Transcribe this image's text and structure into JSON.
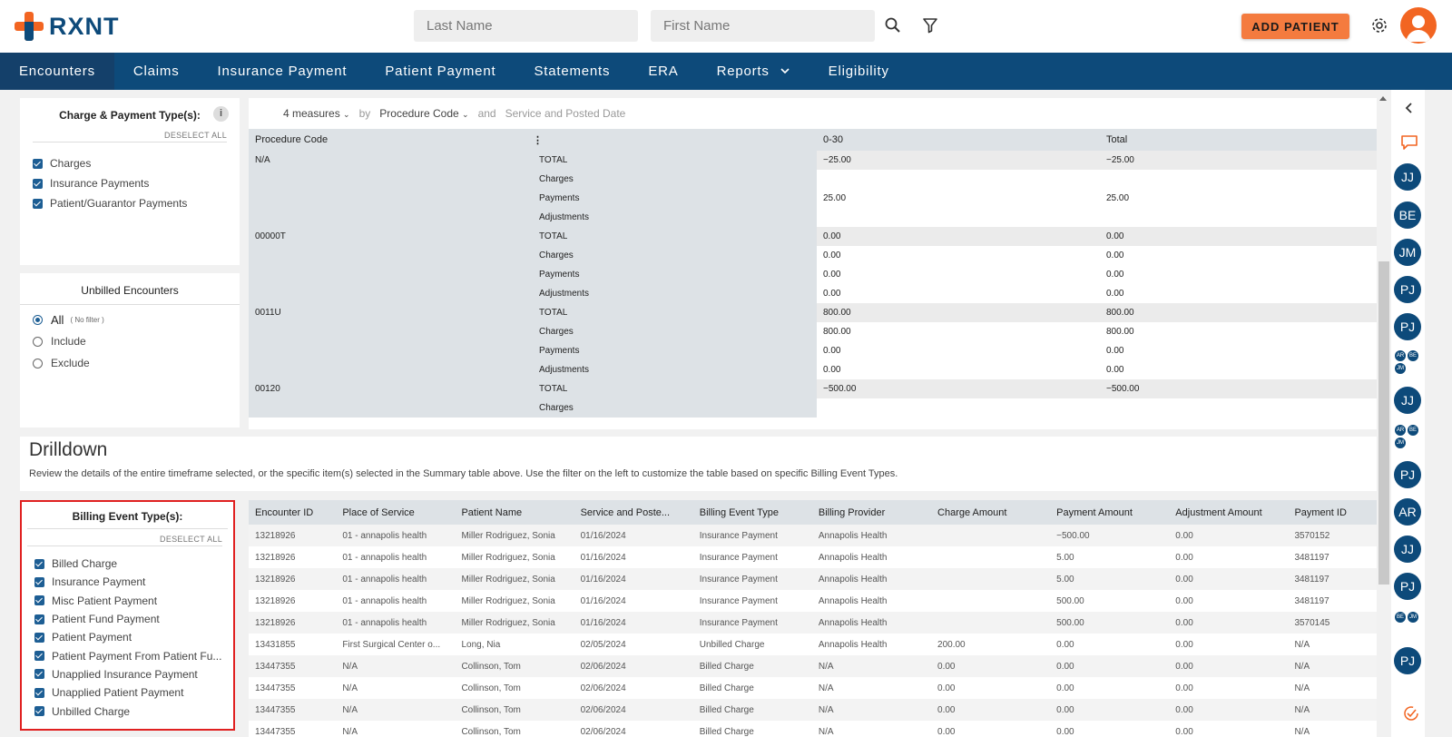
{
  "header": {
    "logo": "RXNT",
    "last_name_placeholder": "Last Name",
    "first_name_placeholder": "First Name",
    "add_patient": "ADD PATIENT"
  },
  "nav": [
    "Encounters",
    "Claims",
    "Insurance Payment",
    "Patient Payment",
    "Statements",
    "ERA",
    "Reports",
    "Eligibility"
  ],
  "charge_filter": {
    "title": "Charge & Payment Type(s):",
    "info": "i",
    "deselect": "DESELECT ALL",
    "items": [
      "Charges",
      "Insurance Payments",
      "Patient/Guarantor Payments"
    ]
  },
  "unbilled": {
    "title": "Unbilled Encounters",
    "options": [
      "All",
      "Include",
      "Exclude"
    ],
    "all_note": "( No filter )"
  },
  "pivot": {
    "measures": "4 measures",
    "by": "by",
    "group": "Procedure Code",
    "and": "and",
    "extra": "Service and Posted Date",
    "col_code": "Procedure Code",
    "col_range": "0-30",
    "col_total": "Total",
    "rows": [
      {
        "code": "N/A",
        "label": "TOTAL",
        "v": "−25.00",
        "t": "−25.00"
      },
      {
        "code": "",
        "label": "Charges",
        "v": "",
        "t": ""
      },
      {
        "code": "",
        "label": "Payments",
        "v": "25.00",
        "t": "25.00"
      },
      {
        "code": "",
        "label": "Adjustments",
        "v": "",
        "t": ""
      },
      {
        "code": "00000T",
        "label": "TOTAL",
        "v": "0.00",
        "t": "0.00"
      },
      {
        "code": "",
        "label": "Charges",
        "v": "0.00",
        "t": "0.00"
      },
      {
        "code": "",
        "label": "Payments",
        "v": "0.00",
        "t": "0.00"
      },
      {
        "code": "",
        "label": "Adjustments",
        "v": "0.00",
        "t": "0.00"
      },
      {
        "code": "0011U",
        "label": "TOTAL",
        "v": "800.00",
        "t": "800.00"
      },
      {
        "code": "",
        "label": "Charges",
        "v": "800.00",
        "t": "800.00"
      },
      {
        "code": "",
        "label": "Payments",
        "v": "0.00",
        "t": "0.00"
      },
      {
        "code": "",
        "label": "Adjustments",
        "v": "0.00",
        "t": "0.00"
      },
      {
        "code": "00120",
        "label": "TOTAL",
        "v": "−500.00",
        "t": "−500.00"
      },
      {
        "code": "",
        "label": "Charges",
        "v": "",
        "t": ""
      }
    ]
  },
  "drilldown": {
    "title": "Drilldown",
    "description": "Review the details of the entire timeframe selected, or the specific item(s) selected in the Summary table above. Use the filter on the left to customize the table based on specific Billing Event Types."
  },
  "billing_filter": {
    "title": "Billing Event Type(s):",
    "deselect": "DESELECT ALL",
    "items": [
      "Billed Charge",
      "Insurance Payment",
      "Misc Patient Payment",
      "Patient Fund Payment",
      "Patient Payment",
      "Patient Payment From Patient Fu...",
      "Unapplied Insurance Payment",
      "Unapplied Patient Payment",
      "Unbilled Charge"
    ]
  },
  "table": {
    "columns": [
      "Encounter ID",
      "Place of Service",
      "Patient Name",
      "Service and Poste...",
      "Billing Event Type",
      "Billing Provider",
      "Charge Amount",
      "Payment Amount",
      "Adjustment Amount",
      "Payment ID"
    ],
    "rows": [
      [
        "13218926",
        "01 - annapolis health",
        "Miller Rodriguez, Sonia",
        "01/16/2024",
        "Insurance Payment",
        "Annapolis Health",
        "",
        "−500.00",
        "0.00",
        "3570152"
      ],
      [
        "13218926",
        "01 - annapolis health",
        "Miller Rodriguez, Sonia",
        "01/16/2024",
        "Insurance Payment",
        "Annapolis Health",
        "",
        "5.00",
        "0.00",
        "3481197"
      ],
      [
        "13218926",
        "01 - annapolis health",
        "Miller Rodriguez, Sonia",
        "01/16/2024",
        "Insurance Payment",
        "Annapolis Health",
        "",
        "5.00",
        "0.00",
        "3481197"
      ],
      [
        "13218926",
        "01 - annapolis health",
        "Miller Rodriguez, Sonia",
        "01/16/2024",
        "Insurance Payment",
        "Annapolis Health",
        "",
        "500.00",
        "0.00",
        "3481197"
      ],
      [
        "13218926",
        "01 - annapolis health",
        "Miller Rodriguez, Sonia",
        "01/16/2024",
        "Insurance Payment",
        "Annapolis Health",
        "",
        "500.00",
        "0.00",
        "3570145"
      ],
      [
        "13431855",
        "First Surgical Center o...",
        "Long, Nia",
        "02/05/2024",
        "Unbilled Charge",
        "Annapolis Health",
        "200.00",
        "0.00",
        "0.00",
        "N/A"
      ],
      [
        "13447355",
        "N/A",
        "Collinson, Tom",
        "02/06/2024",
        "Billed Charge",
        "N/A",
        "0.00",
        "0.00",
        "0.00",
        "N/A"
      ],
      [
        "13447355",
        "N/A",
        "Collinson, Tom",
        "02/06/2024",
        "Billed Charge",
        "N/A",
        "0.00",
        "0.00",
        "0.00",
        "N/A"
      ],
      [
        "13447355",
        "N/A",
        "Collinson, Tom",
        "02/06/2024",
        "Billed Charge",
        "N/A",
        "0.00",
        "0.00",
        "0.00",
        "N/A"
      ],
      [
        "13447355",
        "N/A",
        "Collinson, Tom",
        "02/06/2024",
        "Billed Charge",
        "N/A",
        "0.00",
        "0.00",
        "0.00",
        "N/A"
      ]
    ]
  },
  "chat_rail": {
    "avatars": [
      "JJ",
      "BE",
      "JM",
      "PJ",
      "PJ",
      "JJ",
      "PJ",
      "AR",
      "JJ",
      "PJ",
      "PJ"
    ],
    "groups": [
      [
        "AR",
        "BE",
        "JM"
      ],
      [
        "AR",
        "BE",
        "JM"
      ],
      [
        "BE",
        "JM"
      ]
    ]
  },
  "colors": {
    "brand_blue": "#0d4a7a",
    "brand_orange": "#f26522",
    "button_orange": "#f47b3f",
    "highlight_red": "#e02020"
  }
}
